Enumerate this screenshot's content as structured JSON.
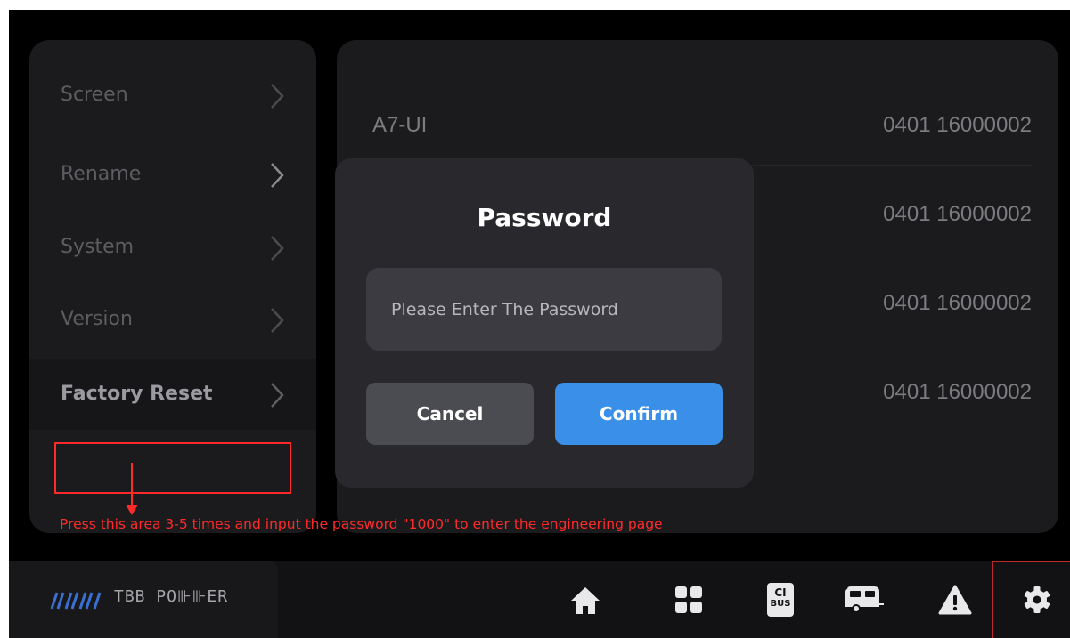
{
  "sidebar": {
    "items": [
      {
        "label": "Screen"
      },
      {
        "label": "Rename"
      },
      {
        "label": "System"
      },
      {
        "label": "Version"
      },
      {
        "label": "Factory Reset",
        "active": true
      }
    ]
  },
  "device_list": [
    {
      "name": "A7-UI",
      "value": "0401 16000002"
    },
    {
      "name": "",
      "value": "0401 16000002"
    },
    {
      "name": "",
      "value": "0401 16000002"
    },
    {
      "name": "",
      "value": "0401 16000002"
    }
  ],
  "dialog": {
    "title": "Password",
    "placeholder": "Please Enter The Password",
    "cancel_label": "Cancel",
    "confirm_label": "Confirm"
  },
  "brand": {
    "name": "TBB POWER",
    "display_text": "TBB PO⊪⊪ER"
  },
  "bottom_nav": [
    {
      "icon": "home-icon"
    },
    {
      "icon": "grid-icon"
    },
    {
      "icon": "ci-bus-icon",
      "label_top": "CI",
      "label_bottom": "BUS"
    },
    {
      "icon": "caravan-icon"
    },
    {
      "icon": "warning-icon"
    },
    {
      "icon": "gear-icon",
      "active": true
    }
  ],
  "annotation": {
    "text": "Press this area 3-5 times and input the password \"1000\" to enter the engineering page"
  },
  "colors": {
    "accent": "#3a8fe8",
    "annotation": "#ff2a2a",
    "background": "#000000"
  }
}
